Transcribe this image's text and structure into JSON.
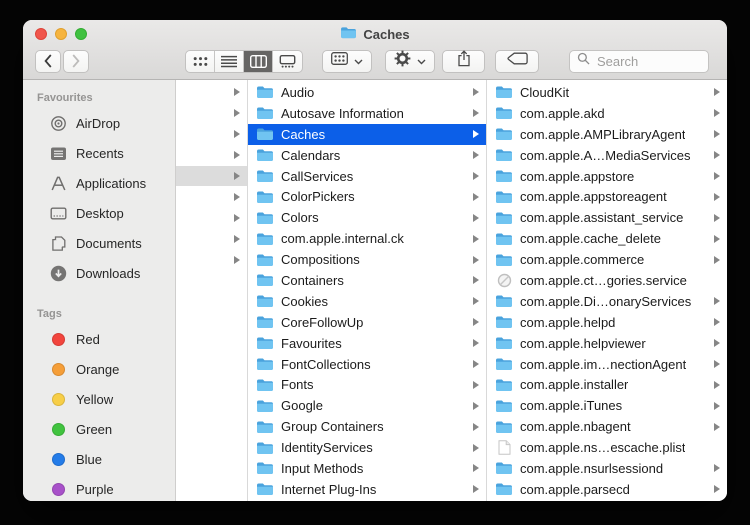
{
  "titlebar": {
    "title": "Caches"
  },
  "toolbar": {
    "view_options": [
      "icon",
      "list",
      "column",
      "gallery"
    ],
    "selected_view": "column",
    "search": {
      "placeholder": "Search"
    }
  },
  "sidebar": {
    "sections": [
      {
        "title": "Favourites",
        "items": [
          {
            "label": "AirDrop",
            "icon": "airdrop-icon"
          },
          {
            "label": "Recents",
            "icon": "recents-icon"
          },
          {
            "label": "Applications",
            "icon": "applications-icon"
          },
          {
            "label": "Desktop",
            "icon": "desktop-icon"
          },
          {
            "label": "Documents",
            "icon": "documents-icon"
          },
          {
            "label": "Downloads",
            "icon": "downloads-icon"
          }
        ]
      },
      {
        "title": "Tags",
        "items": [
          {
            "label": "Red",
            "color": "#f2453d"
          },
          {
            "label": "Orange",
            "color": "#f59e38"
          },
          {
            "label": "Yellow",
            "color": "#f7ce47"
          },
          {
            "label": "Green",
            "color": "#41c33f"
          },
          {
            "label": "Blue",
            "color": "#247ce8"
          },
          {
            "label": "Purple",
            "color": "#a851c9"
          }
        ]
      }
    ]
  },
  "columns": {
    "parent": {
      "selected_index": 4,
      "rows": [
        {
          "chevron": true
        },
        {
          "chevron": true
        },
        {
          "chevron": true
        },
        {
          "chevron": true
        },
        {
          "chevron": true
        },
        {
          "chevron": true
        },
        {
          "chevron": true
        },
        {
          "chevron": true
        },
        {
          "chevron": true
        }
      ]
    },
    "library": {
      "items": [
        {
          "name": "Audio",
          "icon": "folder-icon",
          "chevron": true,
          "selected": false
        },
        {
          "name": "Autosave Information",
          "icon": "folder-icon",
          "chevron": true,
          "selected": false
        },
        {
          "name": "Caches",
          "icon": "folder-icon",
          "chevron": true,
          "selected": true
        },
        {
          "name": "Calendars",
          "icon": "folder-icon",
          "chevron": true,
          "selected": false
        },
        {
          "name": "CallServices",
          "icon": "folder-icon",
          "chevron": true,
          "selected": false
        },
        {
          "name": "ColorPickers",
          "icon": "folder-icon",
          "chevron": true,
          "selected": false
        },
        {
          "name": "Colors",
          "icon": "folder-icon",
          "chevron": true,
          "selected": false
        },
        {
          "name": "com.apple.internal.ck",
          "icon": "folder-icon",
          "chevron": true,
          "selected": false
        },
        {
          "name": "Compositions",
          "icon": "folder-icon",
          "chevron": true,
          "selected": false
        },
        {
          "name": "Containers",
          "icon": "folder-icon",
          "chevron": true,
          "selected": false
        },
        {
          "name": "Cookies",
          "icon": "folder-icon",
          "chevron": true,
          "selected": false
        },
        {
          "name": "CoreFollowUp",
          "icon": "folder-icon",
          "chevron": true,
          "selected": false
        },
        {
          "name": "Favourites",
          "icon": "folder-icon",
          "chevron": true,
          "selected": false
        },
        {
          "name": "FontCollections",
          "icon": "folder-icon",
          "chevron": true,
          "selected": false
        },
        {
          "name": "Fonts",
          "icon": "folder-icon",
          "chevron": true,
          "selected": false
        },
        {
          "name": "Google",
          "icon": "folder-icon",
          "chevron": true,
          "selected": false
        },
        {
          "name": "Group Containers",
          "icon": "folder-icon",
          "chevron": true,
          "selected": false
        },
        {
          "name": "IdentityServices",
          "icon": "folder-icon",
          "chevron": true,
          "selected": false
        },
        {
          "name": "Input Methods",
          "icon": "folder-icon",
          "chevron": true,
          "selected": false
        },
        {
          "name": "Internet Plug-Ins",
          "icon": "folder-icon",
          "chevron": true,
          "selected": false
        }
      ]
    },
    "caches": {
      "items": [
        {
          "name": "CloudKit",
          "icon": "folder-icon",
          "chevron": true,
          "selected": false
        },
        {
          "name": "com.apple.akd",
          "icon": "folder-icon",
          "chevron": true,
          "selected": false
        },
        {
          "name": "com.apple.AMPLibraryAgent",
          "icon": "folder-icon",
          "chevron": true,
          "selected": false
        },
        {
          "name": "com.apple.A…MediaServices",
          "icon": "folder-icon",
          "chevron": true,
          "selected": false
        },
        {
          "name": "com.apple.appstore",
          "icon": "folder-icon",
          "chevron": true,
          "selected": false
        },
        {
          "name": "com.apple.appstoreagent",
          "icon": "folder-icon",
          "chevron": true,
          "selected": false
        },
        {
          "name": "com.apple.assistant_service",
          "icon": "folder-icon",
          "chevron": true,
          "selected": false
        },
        {
          "name": "com.apple.cache_delete",
          "icon": "folder-icon",
          "chevron": true,
          "selected": false
        },
        {
          "name": "com.apple.commerce",
          "icon": "folder-icon",
          "chevron": true,
          "selected": false
        },
        {
          "name": "com.apple.ct…gories.service",
          "icon": "prohibited-icon",
          "chevron": false,
          "selected": false
        },
        {
          "name": "com.apple.Di…onaryServices",
          "icon": "folder-icon",
          "chevron": true,
          "selected": false
        },
        {
          "name": "com.apple.helpd",
          "icon": "folder-icon",
          "chevron": true,
          "selected": false
        },
        {
          "name": "com.apple.helpviewer",
          "icon": "folder-icon",
          "chevron": true,
          "selected": false
        },
        {
          "name": "com.apple.im…nectionAgent",
          "icon": "folder-icon",
          "chevron": true,
          "selected": false
        },
        {
          "name": "com.apple.installer",
          "icon": "folder-icon",
          "chevron": true,
          "selected": false
        },
        {
          "name": "com.apple.iTunes",
          "icon": "folder-icon",
          "chevron": true,
          "selected": false
        },
        {
          "name": "com.apple.nbagent",
          "icon": "folder-icon",
          "chevron": true,
          "selected": false
        },
        {
          "name": "com.apple.ns…escache.plist",
          "icon": "document-icon",
          "chevron": false,
          "selected": false
        },
        {
          "name": "com.apple.nsurlsessiond",
          "icon": "folder-icon",
          "chevron": true,
          "selected": false
        },
        {
          "name": "com.apple.parsecd",
          "icon": "folder-icon",
          "chevron": true,
          "selected": false
        }
      ]
    }
  },
  "colors": {
    "selection_blue": "#0c5fe8",
    "selection_gray": "#dcdcdc",
    "folder_blue": "#70c4f1",
    "sidebar_bg": "#ececeb",
    "chrome_bg": "#e4e3e2"
  }
}
